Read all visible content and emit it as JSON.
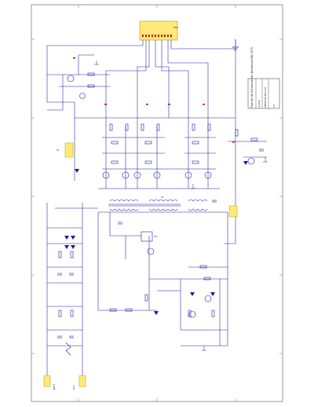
{
  "title_block": {
    "title": "Fuente de Alimentación Kenwood KDC-570",
    "line2": "Inverter",
    "line3": "KENWOOD KDC-570",
    "line4": "1/1"
  },
  "connector": {
    "label": "CN1",
    "pins": [
      "1",
      "2",
      "3",
      "4",
      "5",
      "6",
      "7",
      "8",
      "9",
      "10",
      "11",
      "12"
    ]
  },
  "components": {
    "transformer": "T1",
    "ic_regulator": "IC1",
    "fuse": "F1",
    "input_left": "BATT",
    "input_right": "ACC"
  },
  "colors": {
    "wire": "#1a1aa8",
    "net_label": "#cc0000",
    "component_fill": "#ffe97a",
    "frame": "#444444"
  }
}
